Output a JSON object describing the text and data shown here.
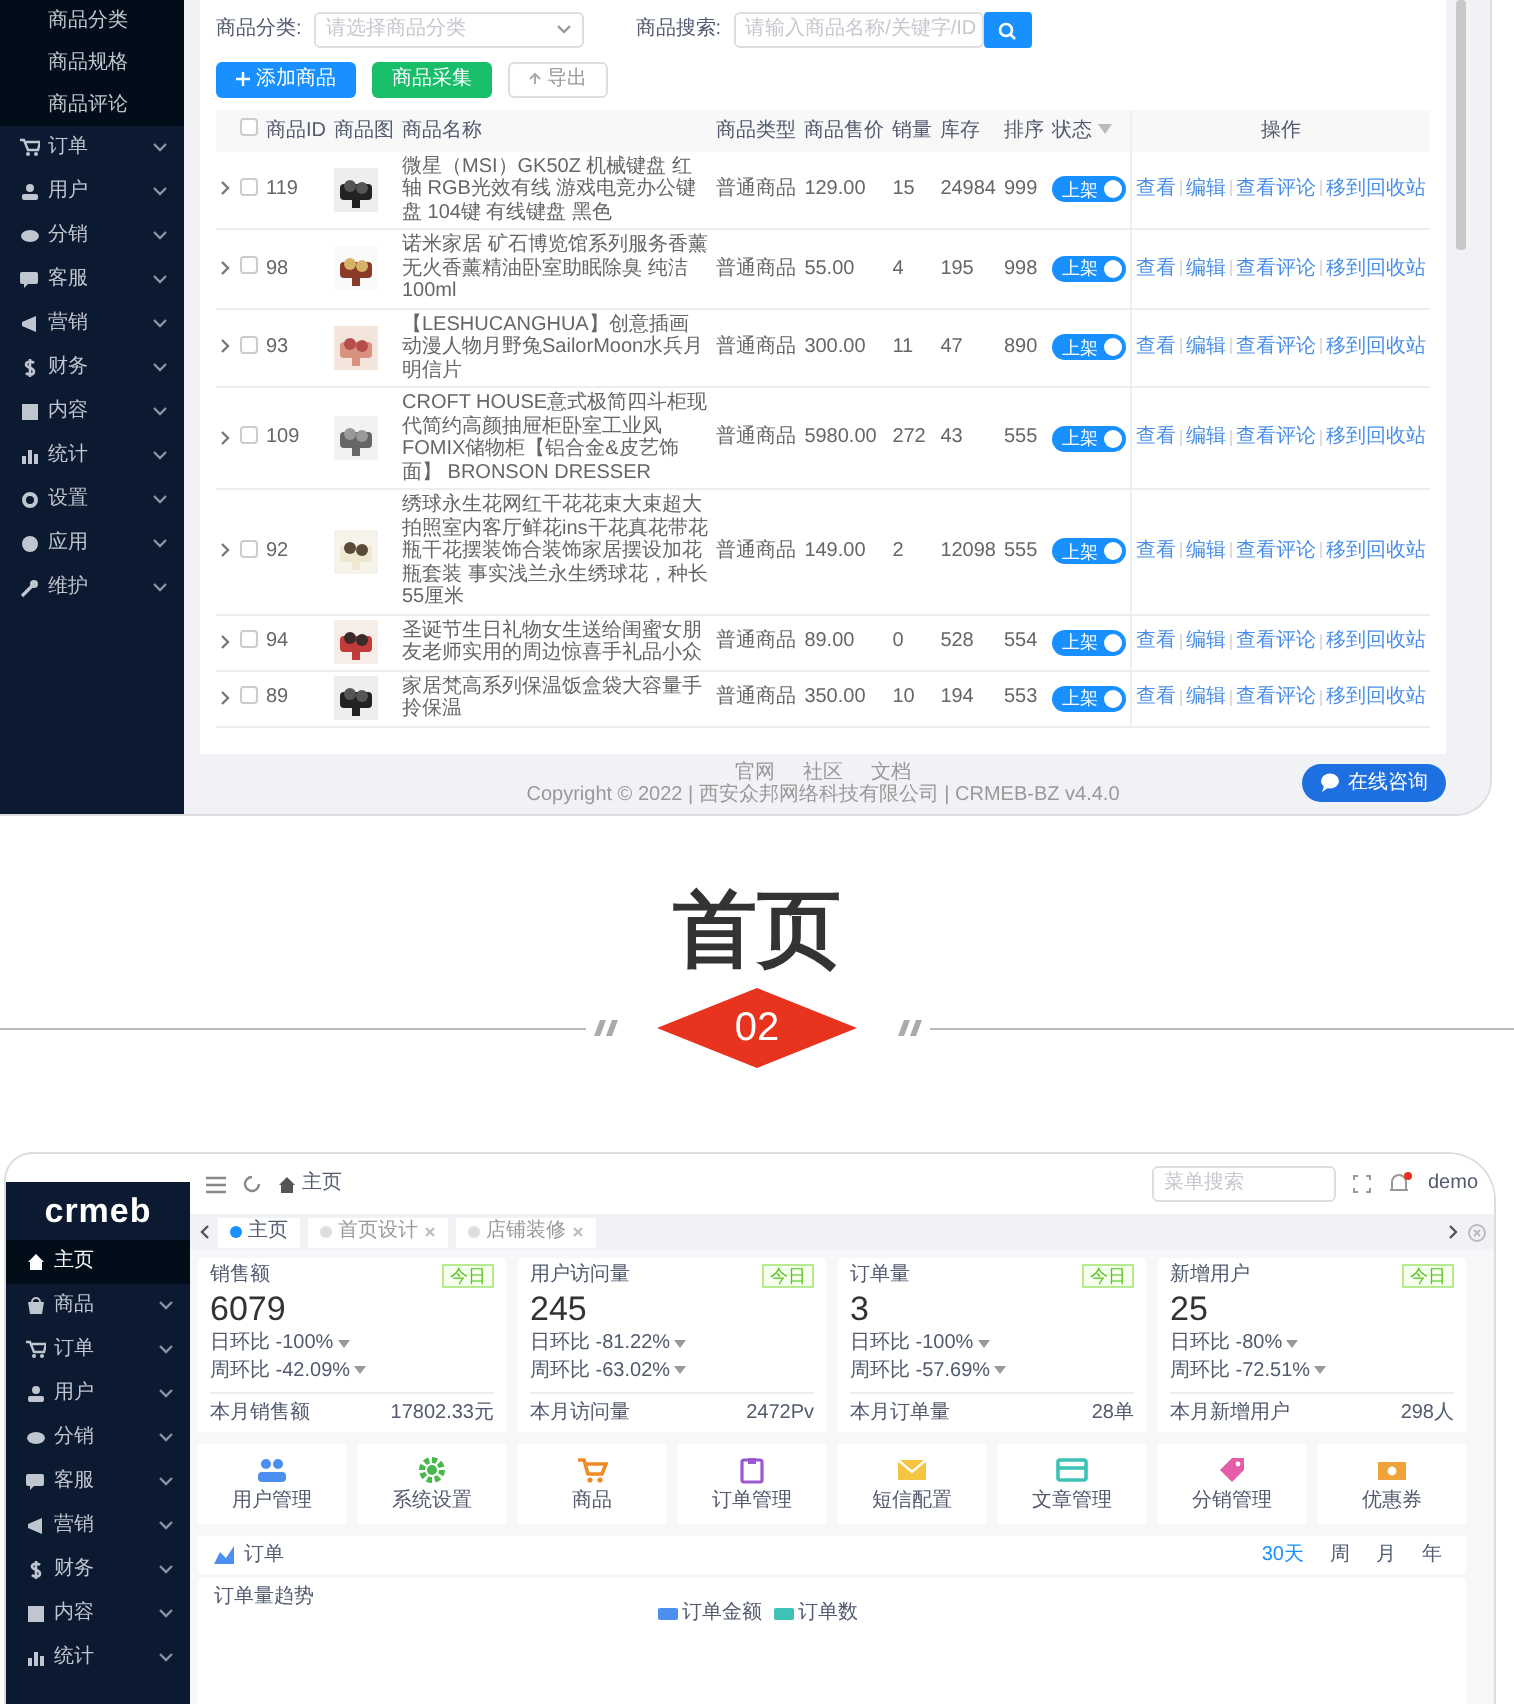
{
  "product_screen": {
    "sidebar": {
      "submenu": [
        {
          "label": "商品分类"
        },
        {
          "label": "商品规格"
        },
        {
          "label": "商品评论"
        }
      ],
      "menu": [
        {
          "label": "订单"
        },
        {
          "label": "用户"
        },
        {
          "label": "分销"
        },
        {
          "label": "客服"
        },
        {
          "label": "营销"
        },
        {
          "label": "财务"
        },
        {
          "label": "内容"
        },
        {
          "label": "统计"
        },
        {
          "label": "设置"
        },
        {
          "label": "应用"
        },
        {
          "label": "维护"
        }
      ]
    },
    "filters": {
      "category_label": "商品分类:",
      "category_placeholder": "请选择商品分类",
      "search_label": "商品搜索:",
      "search_placeholder": "请输入商品名称/关键字/ID"
    },
    "buttons": [
      {
        "label": "添加商品",
        "kind": "primary"
      },
      {
        "label": "商品采集",
        "kind": "success"
      },
      {
        "label": "导出",
        "kind": "plain"
      }
    ],
    "table": {
      "all_checked": false,
      "columns": [
        "商品ID",
        "商品图",
        "商品名称",
        "商品类型",
        "商品售价",
        "销量",
        "库存",
        "排序",
        "状态",
        "操作"
      ],
      "rows": [
        {
          "id": "119",
          "checked": false,
          "name": "微星（MSI）GK50Z 机械键盘 红轴 RGB光效有线 游戏电竞办公键盘 104键 有线键盘 黑色",
          "type": "普通商品",
          "price": "129.00",
          "sales": "15",
          "stock": "24984",
          "sort": "999",
          "status": {
            "label": "上架",
            "on": true
          },
          "actions": [
            "查看",
            "编辑",
            "查看评论",
            "移到回收站"
          ]
        },
        {
          "id": "98",
          "checked": false,
          "name": "诺米家居 矿石博览馆系列服务香薰无火香薰精油卧室助眠除臭 纯洁100ml",
          "type": "普通商品",
          "price": "55.00",
          "sales": "4",
          "stock": "195",
          "sort": "998",
          "status": {
            "label": "上架",
            "on": true
          },
          "actions": [
            "查看",
            "编辑",
            "查看评论",
            "移到回收站"
          ]
        },
        {
          "id": "93",
          "checked": false,
          "name": "【LESHUCANGHUA】创意插画动漫人物月野兔SailorMoon水兵月明信片",
          "type": "普通商品",
          "price": "300.00",
          "sales": "11",
          "stock": "47",
          "sort": "890",
          "status": {
            "label": "上架",
            "on": true
          },
          "actions": [
            "查看",
            "编辑",
            "查看评论",
            "移到回收站"
          ]
        },
        {
          "id": "109",
          "checked": false,
          "name": "CROFT HOUSE意式极简四斗柜现代简约高颜抽屉柜卧室工业风FOMIX储物柜【铝合金&皮艺饰面】 BRONSON DRESSER",
          "type": "普通商品",
          "price": "5980.00",
          "sales": "272",
          "stock": "43",
          "sort": "555",
          "status": {
            "label": "上架",
            "on": true
          },
          "actions": [
            "查看",
            "编辑",
            "查看评论",
            "移到回收站"
          ]
        },
        {
          "id": "92",
          "checked": false,
          "name": "绣球永生花网红干花花束大束超大拍照室内客厅鲜花ins干花真花带花瓶干花摆装饰合装饰家居摆设加花瓶套装 事实浅兰永生绣球花，种长55厘米",
          "type": "普通商品",
          "price": "149.00",
          "sales": "2",
          "stock": "12098",
          "sort": "555",
          "status": {
            "label": "上架",
            "on": true
          },
          "actions": [
            "查看",
            "编辑",
            "查看评论",
            "移到回收站"
          ]
        },
        {
          "id": "94",
          "checked": false,
          "name": "圣诞节生日礼物女生送给闺蜜女朋友老师实用的周边惊喜手礼品小众",
          "type": "普通商品",
          "price": "89.00",
          "sales": "0",
          "stock": "528",
          "sort": "554",
          "status": {
            "label": "上架",
            "on": true
          },
          "actions": [
            "查看",
            "编辑",
            "查看评论",
            "移到回收站"
          ]
        },
        {
          "id": "89",
          "checked": false,
          "name": "家居梵高系列保温饭盒袋大容量手拎保温",
          "type": "普通商品",
          "price": "350.00",
          "sales": "10",
          "stock": "194",
          "sort": "553",
          "status": {
            "label": "上架",
            "on": true
          },
          "actions": [
            "查看",
            "编辑",
            "查看评论",
            "移到回收站"
          ]
        }
      ]
    },
    "footer": {
      "links": [
        "官网",
        "社区",
        "文档"
      ],
      "copyright": "Copyright © 2022 | 西安众邦网络科技有限公司 | CRMEB-BZ v4.4.0"
    },
    "chat_button": "在线咨询"
  },
  "section": {
    "title": "首页",
    "number": "02"
  },
  "dashboard": {
    "logo": "crmeb",
    "sidebar": [
      {
        "label": "主页",
        "selected": true
      },
      {
        "label": "商品",
        "selected": false
      },
      {
        "label": "订单",
        "selected": false
      },
      {
        "label": "用户",
        "selected": false
      },
      {
        "label": "分销",
        "selected": false
      },
      {
        "label": "客服",
        "selected": false
      },
      {
        "label": "营销",
        "selected": false
      },
      {
        "label": "财务",
        "selected": false
      },
      {
        "label": "内容",
        "selected": false
      },
      {
        "label": "统计",
        "selected": false
      }
    ],
    "breadcrumb": "主页",
    "search_placeholder": "菜单搜索",
    "user": "demo",
    "tabs": [
      {
        "label": "主页",
        "selected": true
      },
      {
        "label": "首页设计",
        "selected": false
      },
      {
        "label": "店铺装修",
        "selected": false
      }
    ],
    "stats": [
      {
        "title": "销售额",
        "badge": "今日",
        "value": "6079",
        "day": "日环比 -100%",
        "week": "周环比 -42.09%",
        "month_label": "本月销售额",
        "month_value": "17802.33元"
      },
      {
        "title": "用户访问量",
        "badge": "今日",
        "value": "245",
        "day": "日环比 -81.22%",
        "week": "周环比 -63.02%",
        "month_label": "本月访问量",
        "month_value": "2472Pv"
      },
      {
        "title": "订单量",
        "badge": "今日",
        "value": "3",
        "day": "日环比 -100%",
        "week": "周环比 -57.69%",
        "month_label": "本月订单量",
        "month_value": "28单"
      },
      {
        "title": "新增用户",
        "badge": "今日",
        "value": "25",
        "day": "日环比 -80%",
        "week": "周环比 -72.51%",
        "month_label": "本月新增用户",
        "month_value": "298人"
      }
    ],
    "shortcuts": [
      "用户管理",
      "系统设置",
      "商品",
      "订单管理",
      "短信配置",
      "文章管理",
      "分销管理",
      "优惠券"
    ],
    "orders": {
      "title": "订单",
      "ranges": [
        {
          "label": "30天",
          "selected": true
        },
        {
          "label": "周",
          "selected": false
        },
        {
          "label": "月",
          "selected": false
        },
        {
          "label": "年",
          "selected": false
        }
      ],
      "trend_title": "订单量趋势",
      "legend": [
        "订单金额",
        "订单数"
      ]
    }
  }
}
